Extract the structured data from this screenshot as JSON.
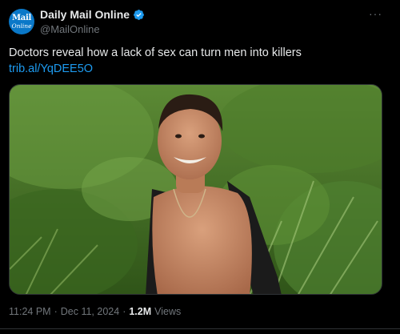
{
  "author": {
    "avatar_line1": "Mail",
    "avatar_line2": "Online",
    "display_name": "Daily Mail Online",
    "handle": "@MailOnline"
  },
  "icons": {
    "verified": "verified-badge-icon",
    "more": "more-options-icon"
  },
  "more_glyph": "···",
  "tweet": {
    "text": "Doctors reveal how a lack of sex can turn men into killers",
    "link": "trib.al/YqDEE5O"
  },
  "meta": {
    "time": "11:24 PM",
    "date": "Dec 11, 2024",
    "views_count": "1.2M",
    "views_label": "Views"
  },
  "colors": {
    "background": "#000000",
    "text": "#e7e9ea",
    "secondary": "#71767b",
    "link": "#1d9bf0",
    "verified": "#1d9bf0",
    "avatar": "#0a78c8"
  }
}
